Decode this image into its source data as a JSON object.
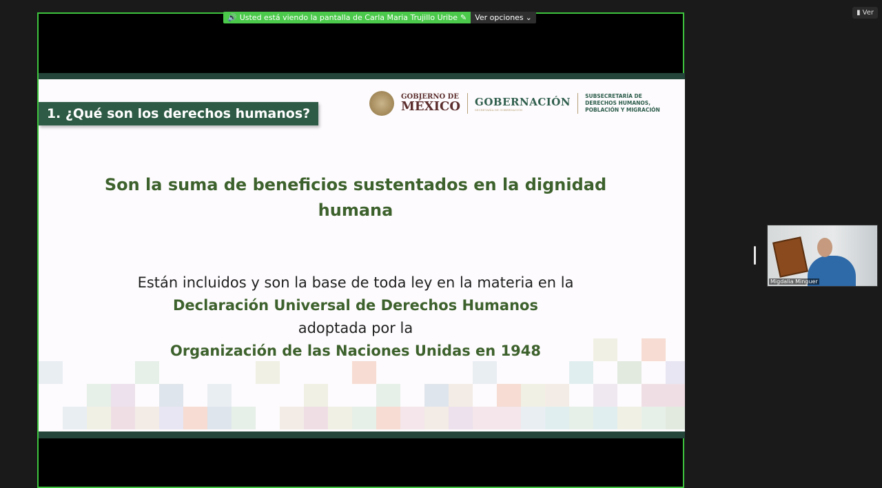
{
  "share_banner": {
    "notice": "Usted está viendo la pantalla de Carla Maria Trujillo Uribe",
    "options_label": "Ver opciones"
  },
  "view_button": {
    "label": "Ver"
  },
  "slide": {
    "section_title": "1. ¿Qué son los derechos humanos?",
    "logos": {
      "gob_line1": "GOBIERNO DE",
      "gob_line2": "MÉXICO",
      "gobernacion": "GOBERNACIÓN",
      "gobernacion_sub": "SECRETARÍA DE GOBERNACIÓN",
      "subsecretaria_l1": "SUBSECRETARÍA DE",
      "subsecretaria_l2": "DERECHOS HUMANOS,",
      "subsecretaria_l3": "POBLACIÓN Y MIGRACIÓN"
    },
    "headline_line1": "Son la suma de beneficios sustentados en la dignidad",
    "headline_line2": "humana",
    "body_line1": "Están incluidos y son la base de toda ley en la materia en la",
    "body_line2": "Declaración Universal de Derechos Humanos",
    "body_line3": "adoptada por la",
    "body_line4": "Organización de las Naciones Unidas en 1948"
  },
  "participant": {
    "name": "Migdalia Minguer"
  },
  "colors": {
    "share_border": "#3ec33e",
    "slide_green": "#3d612c",
    "tag_green": "#2e5b45"
  }
}
